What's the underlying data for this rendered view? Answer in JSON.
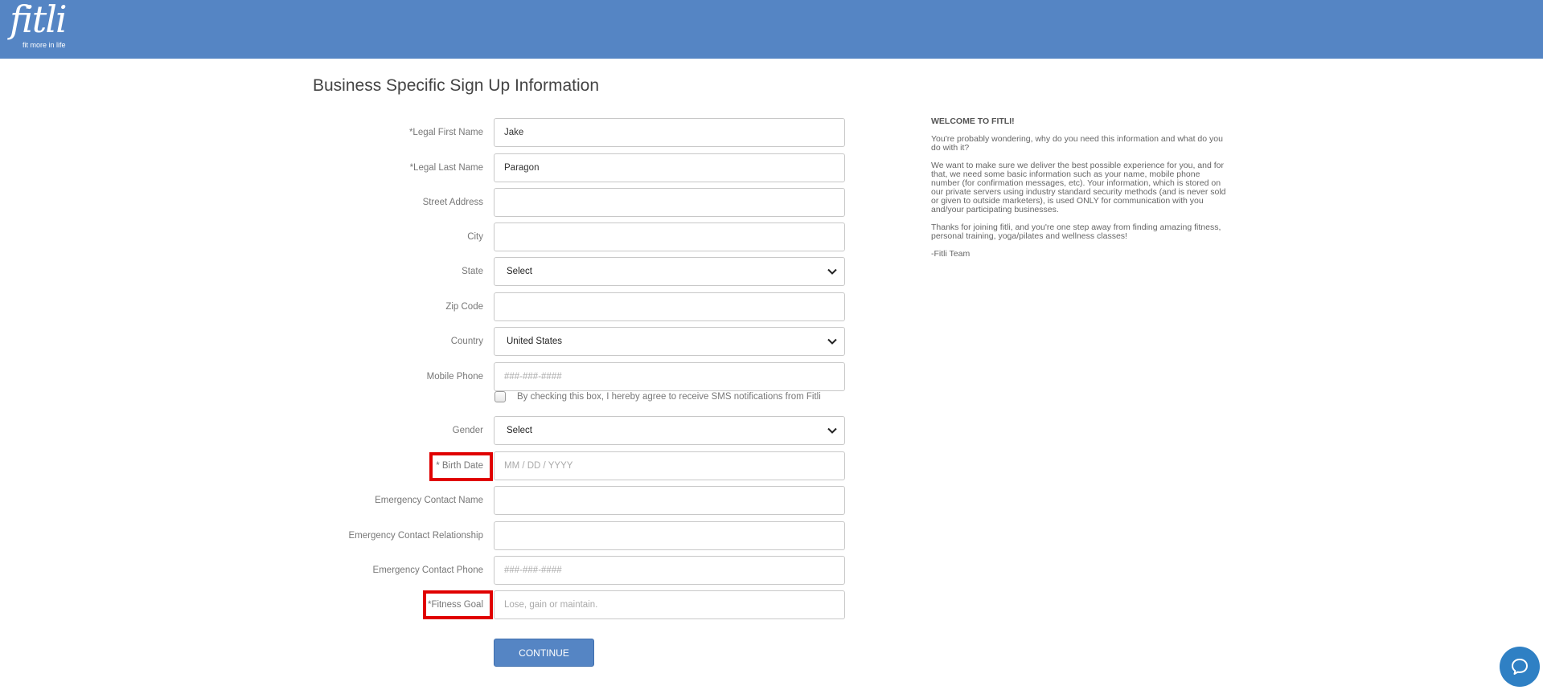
{
  "header": {
    "logo_text": "fitli",
    "logo_tagline": "fit more in life",
    "bg_color": "#5585c4"
  },
  "page": {
    "title": "Business Specific Sign Up Information"
  },
  "form": {
    "first_name": {
      "label": "*Legal First Name",
      "value": "Jake",
      "placeholder": ""
    },
    "last_name": {
      "label": "*Legal Last Name",
      "value": "Paragon",
      "placeholder": ""
    },
    "street": {
      "label": "Street Address",
      "value": "",
      "placeholder": ""
    },
    "city": {
      "label": "City",
      "value": "",
      "placeholder": ""
    },
    "state": {
      "label": "State",
      "selected": "Select"
    },
    "zip": {
      "label": "Zip Code",
      "value": "",
      "placeholder": ""
    },
    "country": {
      "label": "Country",
      "selected": "United States"
    },
    "mobile": {
      "label": "Mobile Phone",
      "value": "",
      "placeholder": "###-###-####"
    },
    "sms": {
      "label": "By checking this box, I hereby agree to receive SMS notifications from Fitli",
      "checked": false
    },
    "gender": {
      "label": "Gender",
      "selected": "Select"
    },
    "birth_date": {
      "label": "* Birth Date",
      "value": "",
      "placeholder": "MM / DD / YYYY"
    },
    "emergency_name": {
      "label": "Emergency Contact Name",
      "value": "",
      "placeholder": ""
    },
    "emergency_relationship": {
      "label": "Emergency Contact Relationship",
      "value": "",
      "placeholder": ""
    },
    "emergency_phone": {
      "label": "Emergency Contact Phone",
      "value": "",
      "placeholder": "###-###-####"
    },
    "fitness_goal": {
      "label": "*Fitness Goal",
      "value": "",
      "placeholder": "Lose, gain or maintain."
    },
    "continue_label": "CONTINUE"
  },
  "welcome": {
    "heading": "WELCOME TO FITLI!",
    "p1": "You're probably wondering, why do you need this information and what do you do with it?",
    "p2": "We want to make sure we deliver the best possible experience for you, and for that, we need some basic information such as your name, mobile phone number (for confirmation messages, etc). Your information, which is stored on our private servers using industry standard security methods (and is never sold or given to outside marketers), is used ONLY for communication with you and/your participating businesses.",
    "p3": "Thanks for joining fitli, and you're one step away from finding amazing fitness, personal training, yoga/pilates and wellness classes!",
    "signature": "-Fitli Team"
  },
  "annotations": {
    "highlight_color": "#e00000"
  },
  "icons": {
    "chat": "chat-bubble-icon",
    "chevron": "chevron-down-icon"
  }
}
